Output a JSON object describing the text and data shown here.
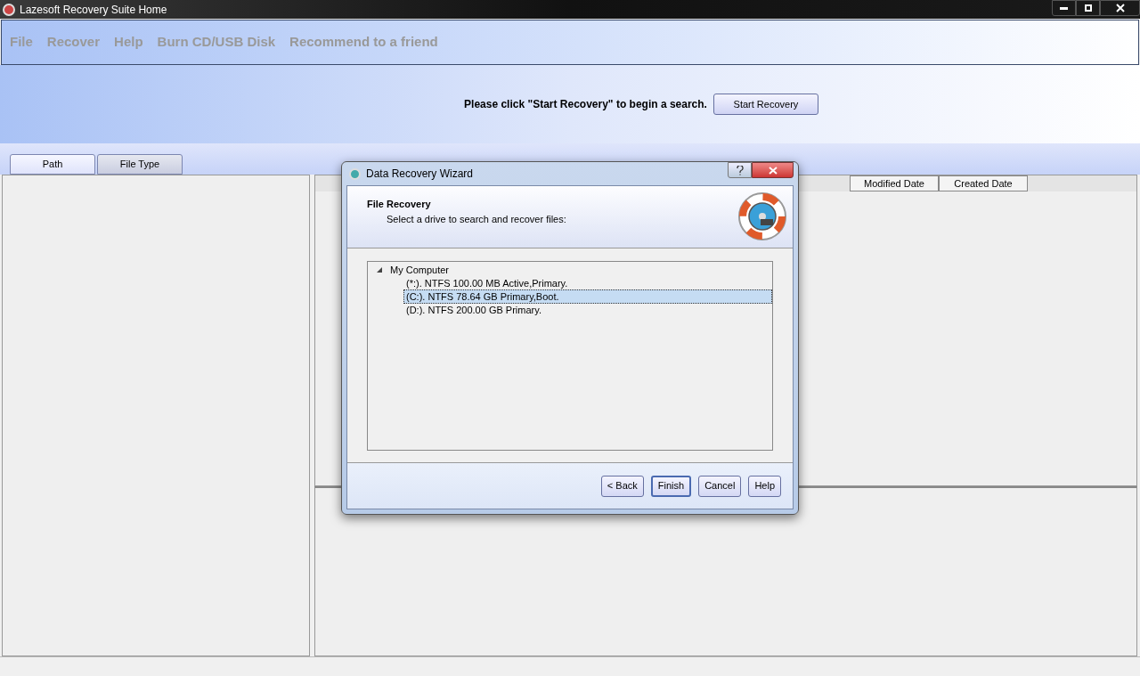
{
  "window": {
    "title": "Lazesoft Recovery Suite Home"
  },
  "menu": [
    "File",
    "Recover",
    "Help",
    "Burn CD/USB Disk",
    "Recommend to a friend"
  ],
  "prompt": {
    "text": "Please click \"Start Recovery\" to begin a search.",
    "button": "Start Recovery"
  },
  "tabs": [
    {
      "label": "Path",
      "selected": true
    },
    {
      "label": "File Type",
      "selected": false
    }
  ],
  "table": {
    "columns": [
      "Modified Date",
      "Created Date"
    ]
  },
  "dialog": {
    "title": "Data Recovery Wizard",
    "heading": "File Recovery",
    "subheading": "Select a drive to search and recover files:",
    "tree": [
      {
        "label": "My Computer",
        "expanded": true,
        "selected": false,
        "children": [
          {
            "label": "(*:). NTFS 100.00 MB Active,Primary.",
            "selected": false
          },
          {
            "label": "(C:). NTFS 78.64 GB Primary,Boot.",
            "selected": true
          },
          {
            "label": "(D:). NTFS 200.00 GB Primary.",
            "selected": false
          }
        ]
      }
    ],
    "buttons": [
      {
        "label": "< Back",
        "default": false
      },
      {
        "label": "Finish",
        "default": true
      },
      {
        "label": "Cancel",
        "default": false
      },
      {
        "label": "Help",
        "default": false
      }
    ]
  }
}
